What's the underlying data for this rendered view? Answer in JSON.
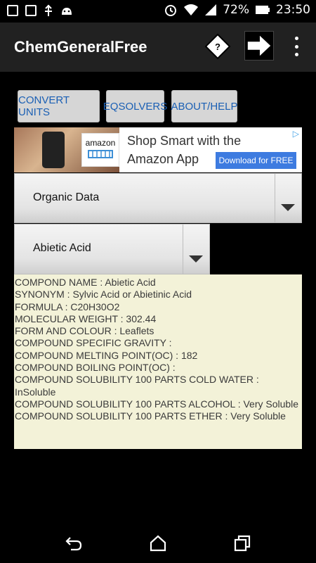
{
  "status_bar": {
    "battery": "72%",
    "time": "23:50",
    "icons": [
      "screen-icon",
      "code-icon",
      "usb-icon",
      "android-icon",
      "alarm-icon",
      "wifi-icon",
      "signal-icon",
      "battery-icon"
    ]
  },
  "app": {
    "title": "ChemGeneralFree",
    "help_icon": "?"
  },
  "toolbar": {
    "convert_units": "CONVERT UNITS",
    "eqsolvers": "EQSOLVERS",
    "about_help": "ABOUT/HELP"
  },
  "ad": {
    "line1": "Shop Smart with the",
    "line2": "Amazon App",
    "cta": "Download for FREE",
    "brand": "amazon"
  },
  "category_select": {
    "value": "Organic Data"
  },
  "compound_select": {
    "value": "Abietic Acid"
  },
  "compound_info": [
    "COMPOND NAME : Abietic Acid",
    "SYNONYM : Sylvic Acid or Abietinic Acid",
    "FORMULA : C20H30O2",
    "MOLECULAR WEIGHT : 302.44",
    "FORM AND COLOUR : Leaflets",
    "COMPOUND SPECIFIC GRAVITY :",
    "COMPOUND MELTING POINT(OC) : 182",
    "COMPOUND BOILING POINT(OC) :",
    "COMPOUND SOLUBILITY 100 PARTS COLD WATER : InSoluble",
    "COMPOUND SOLUBILITY 100 PARTS ALCOHOL : Very Soluble",
    "COMPOUND SOLUBILITY 100 PARTS ETHER : Very Soluble"
  ],
  "colors": {
    "appbar": "#212121",
    "button_text": "#1a5fb4",
    "info_bg": "#f3f2d8",
    "ad_cta": "#3d7be0"
  }
}
